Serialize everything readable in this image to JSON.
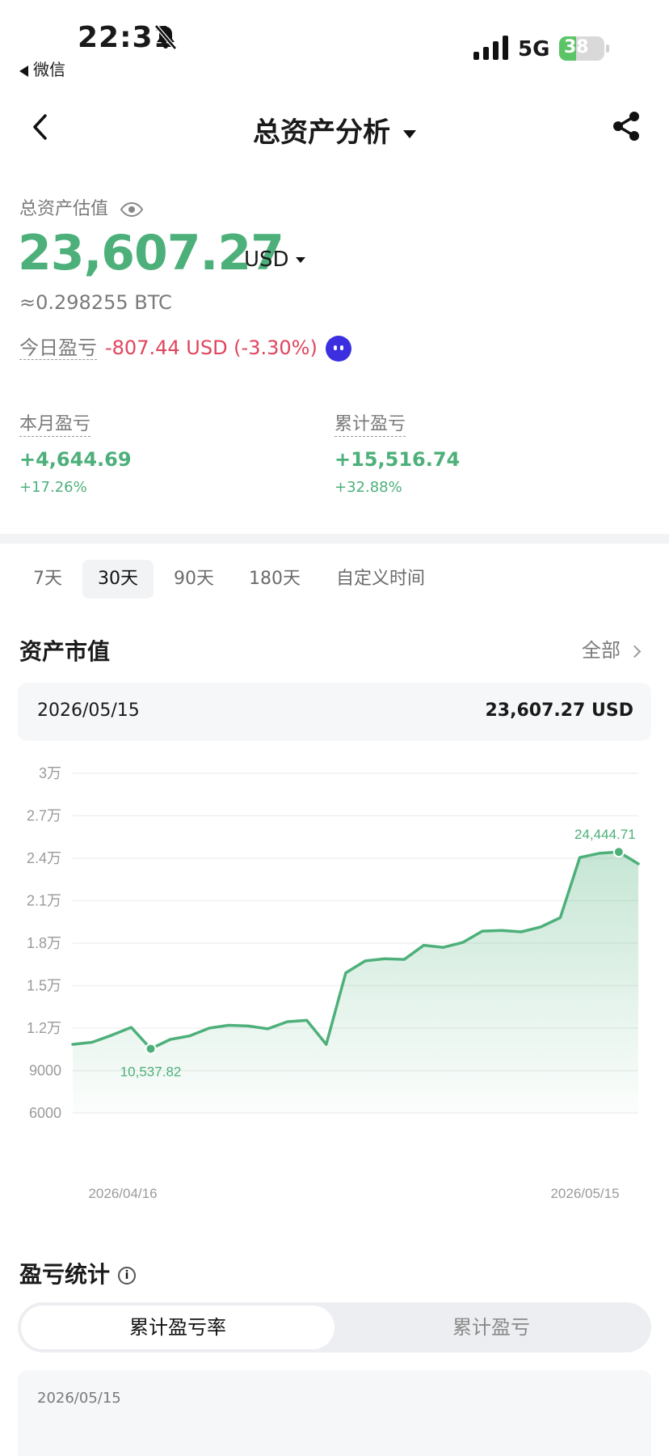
{
  "status_bar": {
    "time": "22:31",
    "back_app": "微信",
    "network": "5G",
    "battery": "38",
    "battery_level": 0.38
  },
  "nav": {
    "title": "总资产分析"
  },
  "summary": {
    "label": "总资产估值",
    "total_value": "23,607.27",
    "currency": "USD",
    "btc_equiv": "≈0.298255 BTC",
    "today_label": "今日盈亏",
    "today_value": "-807.44 USD (-3.30%)"
  },
  "stats": {
    "month": {
      "label": "本月盈亏",
      "value": "+4,644.69",
      "percent": "+17.26%"
    },
    "total": {
      "label": "累计盈亏",
      "value": "+15,516.74",
      "percent": "+32.88%"
    }
  },
  "range_tabs": [
    {
      "label": "7天",
      "active": false
    },
    {
      "label": "30天",
      "active": true
    },
    {
      "label": "90天",
      "active": false
    },
    {
      "label": "180天",
      "active": false
    },
    {
      "label": "自定义时间",
      "active": false
    }
  ],
  "asset_section": {
    "title": "资产市值",
    "all_label": "全部"
  },
  "selected_point": {
    "date": "2026/05/15",
    "value": "23,607.27 USD"
  },
  "colors": {
    "positive": "#4db07a",
    "negative": "#e0445d"
  },
  "chart_data": {
    "type": "area",
    "ylim": [
      6000,
      30000
    ],
    "yticks": [
      {
        "value": 30000,
        "label": "3万"
      },
      {
        "value": 27000,
        "label": "2.7万"
      },
      {
        "value": 24000,
        "label": "2.4万"
      },
      {
        "value": 21000,
        "label": "2.1万"
      },
      {
        "value": 18000,
        "label": "1.8万"
      },
      {
        "value": 15000,
        "label": "1.5万"
      },
      {
        "value": 12000,
        "label": "1.2万"
      },
      {
        "value": 9000,
        "label": "9000"
      },
      {
        "value": 6000,
        "label": "6000"
      }
    ],
    "x_start_label": "2026/04/16",
    "x_end_label": "2026/05/15",
    "values": [
      10850,
      11000,
      11500,
      12050,
      10537.82,
      11200,
      11450,
      12000,
      12200,
      12150,
      11950,
      12450,
      12550,
      10850,
      15900,
      16750,
      16900,
      16850,
      17850,
      17700,
      18050,
      18850,
      18900,
      18800,
      19150,
      19800,
      24050,
      24350,
      24444.71,
      23607.27
    ],
    "min_label": "10,537.82",
    "max_label": "24,444.71",
    "min_index": 4,
    "max_index": 28
  },
  "pl_section": {
    "title": "盈亏统计",
    "tabs": [
      "累计盈亏率",
      "累计盈亏"
    ],
    "date": "2026/05/15"
  }
}
